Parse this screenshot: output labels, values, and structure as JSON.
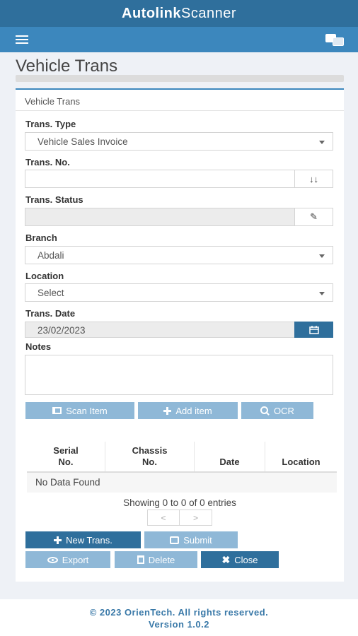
{
  "app": {
    "brand_bold": "Autolink",
    "brand_light": "Scanner"
  },
  "page": {
    "title": "Vehicle Trans"
  },
  "card": {
    "header": "Vehicle Trans"
  },
  "form": {
    "trans_type": {
      "label": "Trans. Type",
      "value": "Vehicle Sales Invoice"
    },
    "trans_no": {
      "label": "Trans. No.",
      "value": "",
      "addon": "↓↓"
    },
    "trans_status": {
      "label": "Trans. Status",
      "value": "",
      "addon": "✎"
    },
    "branch": {
      "label": "Branch",
      "value": "Abdali"
    },
    "location": {
      "label": "Location",
      "value": "Select"
    },
    "trans_date": {
      "label": "Trans. Date",
      "value": "23/02/2023"
    },
    "notes": {
      "label": "Notes",
      "value": ""
    }
  },
  "actions": {
    "scan_item": "Scan Item",
    "add_item": "Add item",
    "ocr": "OCR"
  },
  "table": {
    "headers": [
      {
        "line1": "Serial",
        "line2": "No."
      },
      {
        "line1": "Chassis",
        "line2": "No."
      },
      {
        "line1": "Date",
        "line2": ""
      },
      {
        "line1": "Location",
        "line2": ""
      }
    ],
    "empty_text": "No Data Found",
    "showing": "Showing 0 to 0 of 0 entries",
    "prev": "<",
    "next": ">"
  },
  "buttons": {
    "new_trans": "New Trans.",
    "submit": "Submit",
    "export": "Export",
    "delete": "Delete",
    "close": "Close"
  },
  "footer": {
    "copyright": "© 2023 OrienTech. All rights reserved.",
    "version": "Version 1.0.2"
  },
  "colors": {
    "primary": "#2f6f9c",
    "navbar": "#3c87bd",
    "button_light": "#8fb8d7"
  }
}
